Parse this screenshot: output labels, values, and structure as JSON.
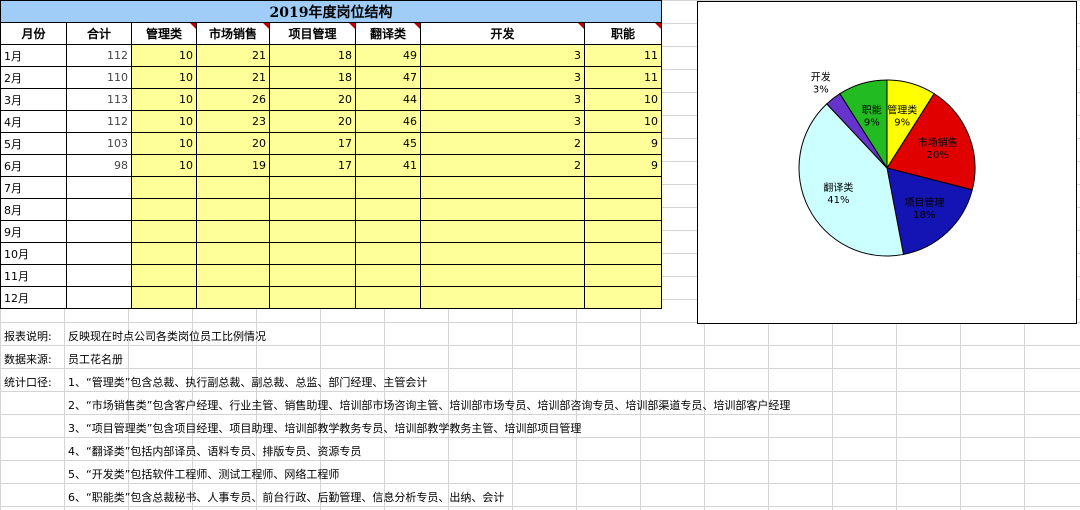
{
  "sheet": {
    "title": "2019年度岗位结构",
    "headers": [
      "月份",
      "合计",
      "管理类",
      "市场销售",
      "项目管理",
      "翻译类",
      "开发",
      "职能"
    ],
    "rows": [
      {
        "month": "1月",
        "total": "112",
        "vals": [
          "10",
          "21",
          "18",
          "49",
          "3",
          "11"
        ]
      },
      {
        "month": "2月",
        "total": "110",
        "vals": [
          "10",
          "21",
          "18",
          "47",
          "3",
          "11"
        ]
      },
      {
        "month": "3月",
        "total": "113",
        "vals": [
          "10",
          "26",
          "20",
          "44",
          "3",
          "10"
        ]
      },
      {
        "month": "4月",
        "total": "112",
        "vals": [
          "10",
          "23",
          "20",
          "46",
          "3",
          "10"
        ]
      },
      {
        "month": "5月",
        "total": "103",
        "vals": [
          "10",
          "20",
          "17",
          "45",
          "2",
          "9"
        ]
      },
      {
        "month": "6月",
        "total": "98",
        "vals": [
          "10",
          "19",
          "17",
          "41",
          "2",
          "9"
        ]
      },
      {
        "month": "7月",
        "total": "",
        "vals": [
          "",
          "",
          "",
          "",
          "",
          ""
        ]
      },
      {
        "month": "8月",
        "total": "",
        "vals": [
          "",
          "",
          "",
          "",
          "",
          ""
        ]
      },
      {
        "month": "9月",
        "total": "",
        "vals": [
          "",
          "",
          "",
          "",
          "",
          ""
        ]
      },
      {
        "month": "10月",
        "total": "",
        "vals": [
          "",
          "",
          "",
          "",
          "",
          ""
        ]
      },
      {
        "month": "11月",
        "total": "",
        "vals": [
          "",
          "",
          "",
          "",
          "",
          ""
        ]
      },
      {
        "month": "12月",
        "total": "",
        "vals": [
          "",
          "",
          "",
          "",
          "",
          ""
        ]
      }
    ]
  },
  "notes": [
    {
      "label": "报表说明:",
      "text": "反映现在时点公司各类岗位员工比例情况"
    },
    {
      "label": "数据来源:",
      "text": "员工花名册"
    },
    {
      "label": "统计口径:",
      "text": "1、“管理类”包含总裁、执行副总裁、副总裁、总监、部门经理、主管会计"
    },
    {
      "label": "",
      "text": "2、“市场销售类”包含客户经理、行业主管、销售助理、培训部市场咨询主管、培训部市场专员、培训部咨询专员、培训部渠道专员、培训部客户经理"
    },
    {
      "label": "",
      "text": "3、“项目管理类”包含项目经理、项目助理、培训部教学教务专员、培训部教学教务主管、培训部项目管理"
    },
    {
      "label": "",
      "text": "4、“翻译类”包括内部译员、语料专员、排版专员、资源专员"
    },
    {
      "label": "",
      "text": "5、“开发类”包括软件工程师、测试工程师、网络工程师"
    },
    {
      "label": "",
      "text": "6、“职能类”包含总裁秘书、人事专员、前台行政、后勤管理、信息分析专员、出纳、会计"
    }
  ],
  "chart_data": {
    "type": "pie",
    "slices": [
      {
        "name": "管理类",
        "value": 9,
        "label": "9%",
        "color": "#ffff00"
      },
      {
        "name": "市场销售",
        "value": 20,
        "label": "20%",
        "color": "#e00000"
      },
      {
        "name": "项目管理",
        "value": 18,
        "label": "18%",
        "color": "#1414b4"
      },
      {
        "name": "翻译类",
        "value": 41,
        "label": "41%",
        "color": "#ccffff"
      },
      {
        "name": "开发",
        "value": 3,
        "label": "3%",
        "color": "#6633cc"
      },
      {
        "name": "职能",
        "value": 9,
        "label": "9%",
        "color": "#22bb22"
      }
    ]
  }
}
